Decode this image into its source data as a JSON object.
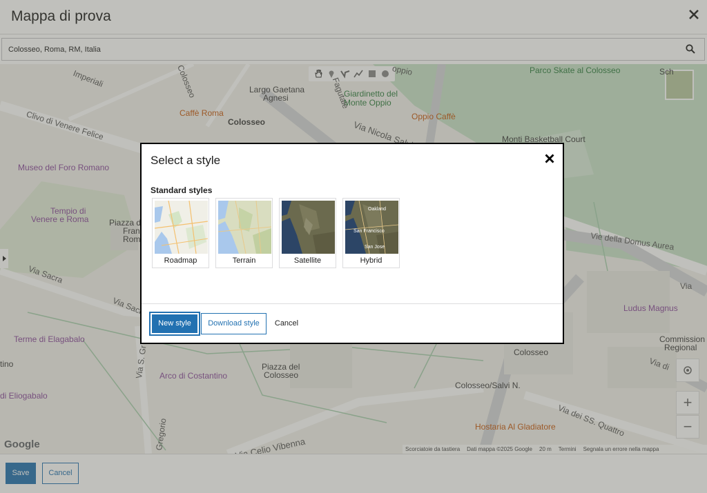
{
  "page": {
    "title": "Mappa di prova",
    "close_label": "✕"
  },
  "search": {
    "value": "Colosseo, Roma, RM, Italia"
  },
  "map": {
    "poi": {
      "caffe_roma": "Caffè Roma",
      "largo_gaetana": "Largo Gaetana",
      "agnesi": "Agnesi",
      "colosseo": "Colosseo",
      "giardinetto": "Giardinetto del",
      "monte_oppio": "Monte Oppio",
      "oppio_caffe": "Oppio Caffè",
      "parco_skate": "Parco Skate al Colosseo",
      "monti_basket": "Monti Basketball Court",
      "museo_foro": "Museo del Foro Romano",
      "tempio1": "Tempio di",
      "tempio2": "Venere e Roma",
      "piazza_del": "Piazza del",
      "francesca": "Franc",
      "romana": "Rom",
      "terme_elagabalo": "Terme di Elagabalo",
      "arco_costantino": "Arco di Costantino",
      "piazza_colosseo1": "Piazza del",
      "piazza_colosseo2": "Colosseo",
      "colosseo_stop": "Colosseo",
      "colosseo_salvi": "Colosseo/Salvi N.",
      "hostaria": "Hostaria Al Gladiatore",
      "ludus": "Ludus Magnus",
      "commissione1": "Commission",
      "commissione2": "Regional",
      "tino": "tino",
      "di_eliogabalo": "di Eliogabalo",
      "sch": "Sch"
    },
    "roads": {
      "clivo_venere": "Clivo di Venere Felice",
      "via_nicola": "Via Nicola Salvi",
      "via_sacra": "Via Sacra",
      "via_sacra2": "Via Sacra",
      "via_domus": "Vie della Domus Aurea",
      "via_labicana": "Via di S.",
      "via_ss_quattro": "Via dei SS. Quattro",
      "celio_vibenna": "Via Celio Vibenna",
      "imperiali": "Imperiali",
      "colosseo_road": "Colosseo",
      "fagutale": "Fagutale",
      "oppio": "oppio",
      "via_s_gregorio": "Via S. Gr",
      "gregorio": "Gregorio",
      "via_labicana2": "Via",
      "via_di": "Via di"
    },
    "google": "Google",
    "attribution": [
      "Scorciatoie da tastiera",
      "Dati mappa ©2025 Google",
      "20 m",
      "Termini",
      "Segnala un errore nella mappa"
    ],
    "zoom_in": "+",
    "zoom_out": "−"
  },
  "footer": {
    "save": "Save",
    "cancel": "Cancel"
  },
  "modal": {
    "title": "Select a style",
    "section": "Standard styles",
    "styles": [
      "Roadmap",
      "Terrain",
      "Satellite",
      "Hybrid"
    ],
    "hybrid_labels": [
      "Oakland",
      "San Francisco",
      "San Jose"
    ],
    "buttons": {
      "new": "New style",
      "download": "Download style",
      "cancel": "Cancel"
    }
  }
}
